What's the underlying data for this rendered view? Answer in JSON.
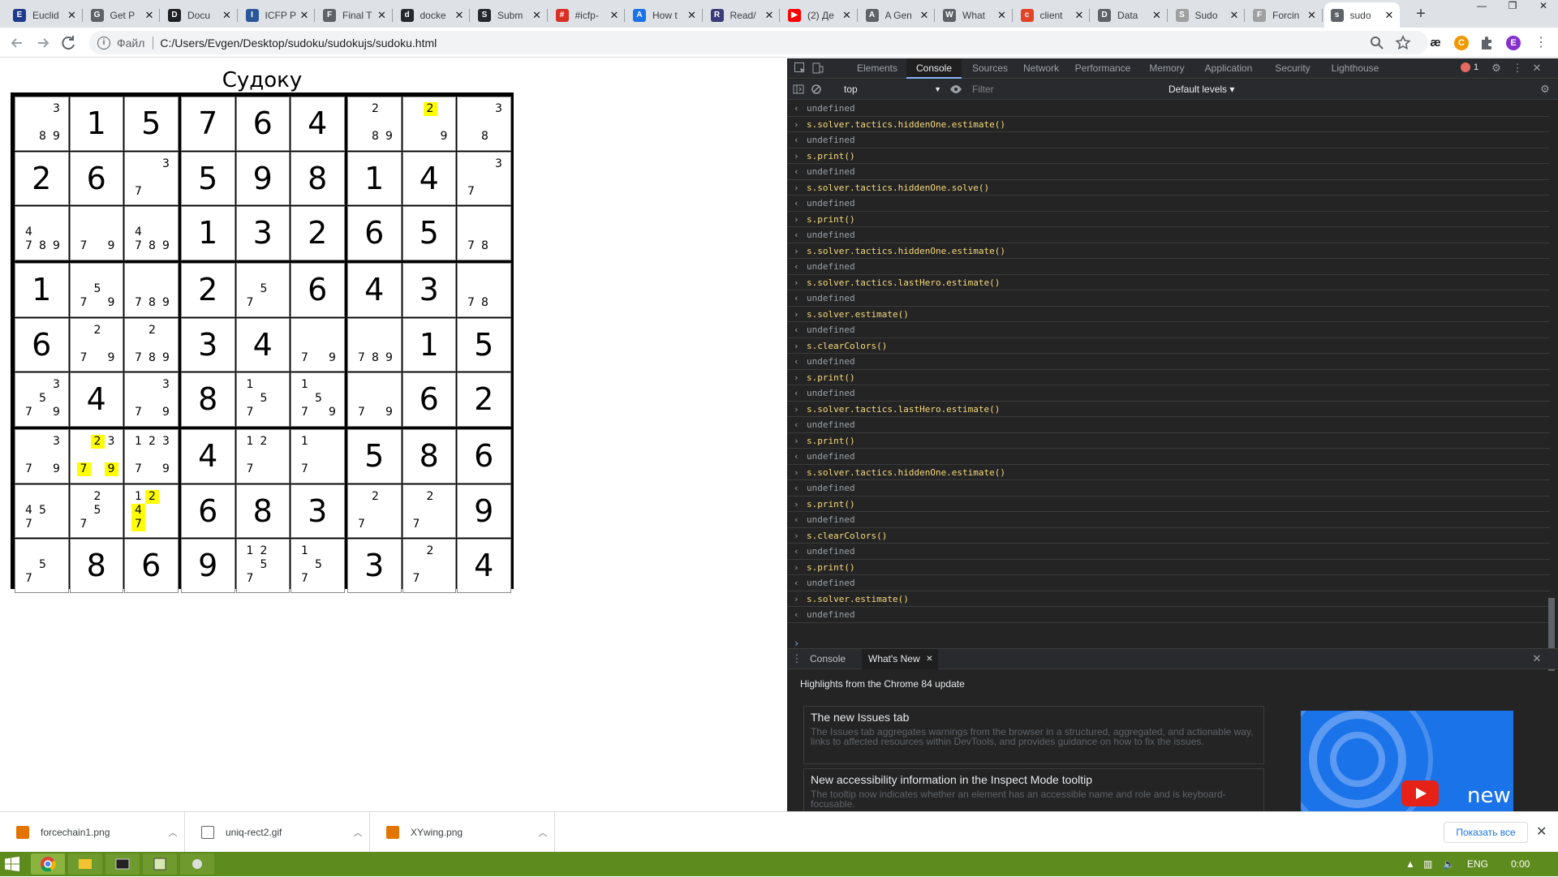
{
  "browser": {
    "tabs": [
      {
        "title": "Euclid",
        "color": "#1e3a8a",
        "glyph": "E"
      },
      {
        "title": "Get P",
        "color": "#5f6368",
        "glyph": "G"
      },
      {
        "title": "Docu",
        "color": "#202124",
        "glyph": "D"
      },
      {
        "title": "ICFP P",
        "color": "#2b579a",
        "glyph": "I"
      },
      {
        "title": "Final T",
        "color": "#5f6368",
        "glyph": "F"
      },
      {
        "title": "docke",
        "color": "#24292e",
        "glyph": "d"
      },
      {
        "title": "Subm",
        "color": "#24292e",
        "glyph": "S"
      },
      {
        "title": "#icfp-",
        "color": "#d93025",
        "glyph": "#"
      },
      {
        "title": "How t",
        "color": "#1a73e8",
        "glyph": "A"
      },
      {
        "title": "Read/",
        "color": "#3b3b7a",
        "glyph": "R"
      },
      {
        "title": "(2) Де",
        "color": "#ff0000",
        "glyph": "▶"
      },
      {
        "title": "A Gen",
        "color": "#5f6368",
        "glyph": "A"
      },
      {
        "title": "What",
        "color": "#5f6368",
        "glyph": "W"
      },
      {
        "title": "client",
        "color": "#e24329",
        "glyph": "c"
      },
      {
        "title": "Data",
        "color": "#5f6368",
        "glyph": "D"
      },
      {
        "title": "Sudo",
        "color": "#a0a0a0",
        "glyph": "S"
      },
      {
        "title": "Forcin",
        "color": "#a0a0a0",
        "glyph": "F"
      },
      {
        "title": "sudo",
        "color": "#5f6368",
        "glyph": "s"
      }
    ],
    "active_tab_index": 17,
    "new_tab": "+",
    "close": "✕",
    "window_controls": [
      "—",
      "❐",
      "✕"
    ],
    "address_label": "Файл",
    "url": "C:/Users/Evgen/Desktop/sudoku/sudokujs/sudoku.html",
    "profile_letter": "E",
    "ext_ae": "æ"
  },
  "page": {
    "title": "Судоку",
    "cells": [
      {
        "c": [
          3,
          8,
          9
        ]
      },
      {
        "v": 1
      },
      {
        "v": 5
      },
      {
        "v": 7
      },
      {
        "v": 6
      },
      {
        "v": 4
      },
      {
        "c": [
          2,
          8,
          9
        ]
      },
      {
        "c": [
          2,
          9
        ],
        "h": [
          2
        ]
      },
      {
        "c": [
          3,
          8
        ]
      },
      {
        "v": 2
      },
      {
        "v": 6
      },
      {
        "c": [
          3,
          7
        ]
      },
      {
        "v": 5
      },
      {
        "v": 9
      },
      {
        "v": 8
      },
      {
        "v": 1
      },
      {
        "v": 4
      },
      {
        "c": [
          3,
          7
        ]
      },
      {
        "c": [
          4,
          7,
          8,
          9
        ]
      },
      {
        "c": [
          7,
          9
        ]
      },
      {
        "c": [
          4,
          7,
          8,
          9
        ]
      },
      {
        "v": 1
      },
      {
        "v": 3
      },
      {
        "v": 2
      },
      {
        "v": 6
      },
      {
        "v": 5
      },
      {
        "c": [
          7,
          8
        ]
      },
      {
        "v": 1
      },
      {
        "c": [
          5,
          7,
          9
        ]
      },
      {
        "c": [
          7,
          8,
          9
        ]
      },
      {
        "v": 2
      },
      {
        "c": [
          5,
          7
        ]
      },
      {
        "v": 6
      },
      {
        "v": 4
      },
      {
        "v": 3
      },
      {
        "c": [
          7,
          8
        ]
      },
      {
        "v": 6
      },
      {
        "c": [
          2,
          7,
          9
        ]
      },
      {
        "c": [
          2,
          7,
          8,
          9
        ]
      },
      {
        "v": 3
      },
      {
        "v": 4
      },
      {
        "c": [
          7,
          9
        ]
      },
      {
        "c": [
          7,
          8,
          9
        ]
      },
      {
        "v": 1
      },
      {
        "v": 5
      },
      {
        "c": [
          3,
          5,
          7,
          9
        ]
      },
      {
        "v": 4
      },
      {
        "c": [
          3,
          7,
          9
        ]
      },
      {
        "v": 8
      },
      {
        "c": [
          1,
          5,
          7
        ]
      },
      {
        "c": [
          1,
          5,
          7,
          9
        ]
      },
      {
        "c": [
          7,
          9
        ]
      },
      {
        "v": 6
      },
      {
        "v": 2
      },
      {
        "c": [
          3,
          7,
          9
        ]
      },
      {
        "c": [
          2,
          3,
          7,
          9
        ],
        "h": [
          2,
          7,
          9
        ]
      },
      {
        "c": [
          1,
          2,
          3,
          7,
          9
        ]
      },
      {
        "v": 4
      },
      {
        "c": [
          1,
          2,
          7
        ]
      },
      {
        "c": [
          1,
          7
        ]
      },
      {
        "v": 5
      },
      {
        "v": 8
      },
      {
        "v": 6
      },
      {
        "c": [
          4,
          5,
          7
        ]
      },
      {
        "c": [
          2,
          5,
          7
        ]
      },
      {
        "c": [
          1,
          2,
          4,
          7
        ],
        "h": [
          2,
          4,
          7
        ]
      },
      {
        "v": 6
      },
      {
        "v": 8
      },
      {
        "v": 3
      },
      {
        "c": [
          2,
          7
        ]
      },
      {
        "c": [
          2,
          7
        ]
      },
      {
        "v": 9
      },
      {
        "c": [
          5,
          7
        ]
      },
      {
        "v": 8
      },
      {
        "v": 6
      },
      {
        "v": 9
      },
      {
        "c": [
          1,
          2,
          5,
          7
        ]
      },
      {
        "c": [
          1,
          5,
          7
        ]
      },
      {
        "v": 3
      },
      {
        "c": [
          2,
          7
        ]
      },
      {
        "v": 4
      }
    ]
  },
  "devtools": {
    "tabs": [
      "Elements",
      "Console",
      "Sources",
      "Network",
      "Performance",
      "Memory",
      "Application",
      "Security",
      "Lighthouse"
    ],
    "active_tab": "Console",
    "error_count": "1",
    "context": "top",
    "filter_placeholder": "Filter",
    "levels": "Default levels ▾",
    "log": [
      {
        "t": "out",
        "s": "undefined"
      },
      {
        "t": "in",
        "s": "s.solver.tactics.hiddenOne.estimate()"
      },
      {
        "t": "out",
        "s": "undefined"
      },
      {
        "t": "in",
        "s": "s.print()"
      },
      {
        "t": "out",
        "s": "undefined"
      },
      {
        "t": "in",
        "s": "s.solver.tactics.hiddenOne.solve()"
      },
      {
        "t": "out",
        "s": "undefined"
      },
      {
        "t": "in",
        "s": "s.print()"
      },
      {
        "t": "out",
        "s": "undefined"
      },
      {
        "t": "in",
        "s": "s.solver.tactics.hiddenOne.estimate()"
      },
      {
        "t": "out",
        "s": "undefined"
      },
      {
        "t": "in",
        "s": "s.solver.tactics.lastHero.estimate()"
      },
      {
        "t": "out",
        "s": "undefined"
      },
      {
        "t": "in",
        "s": "s.solver.estimate()"
      },
      {
        "t": "out",
        "s": "undefined"
      },
      {
        "t": "in",
        "s": "s.clearColors()"
      },
      {
        "t": "out",
        "s": "undefined"
      },
      {
        "t": "in",
        "s": "s.print()"
      },
      {
        "t": "out",
        "s": "undefined"
      },
      {
        "t": "in",
        "s": "s.solver.tactics.lastHero.estimate()"
      },
      {
        "t": "out",
        "s": "undefined"
      },
      {
        "t": "in",
        "s": "s.print()"
      },
      {
        "t": "out",
        "s": "undefined"
      },
      {
        "t": "in",
        "s": "s.solver.tactics.hiddenOne.estimate()"
      },
      {
        "t": "out",
        "s": "undefined"
      },
      {
        "t": "in",
        "s": "s.print()"
      },
      {
        "t": "out",
        "s": "undefined"
      },
      {
        "t": "in",
        "s": "s.clearColors()"
      },
      {
        "t": "out",
        "s": "undefined"
      },
      {
        "t": "in",
        "s": "s.print()"
      },
      {
        "t": "out",
        "s": "undefined"
      },
      {
        "t": "in",
        "s": "s.solver.estimate()"
      },
      {
        "t": "out",
        "s": "undefined"
      }
    ],
    "drawer_tabs": [
      "Console",
      "What's New"
    ],
    "whatsnew_title": "Highlights from the Chrome 84 update",
    "news": [
      {
        "heading": "The new Issues tab",
        "desc": "The Issues tab aggregates warnings from the browser in a structured, aggregated, and actionable way, links to affected resources within DevTools, and provides guidance on how to fix the issues."
      },
      {
        "heading": "New accessibility information in the Inspect Mode tooltip",
        "desc": "The tooltip now indicates whether an element has an accessible name and role and is keyboard-focusable."
      }
    ],
    "video_label": "new"
  },
  "downloads": {
    "items": [
      "forcechain1.png",
      "uniq-rect2.gif",
      "XYwing.png"
    ],
    "show_all": "Показать все"
  },
  "taskbar": {
    "lang": "ENG",
    "time": "0:00"
  }
}
